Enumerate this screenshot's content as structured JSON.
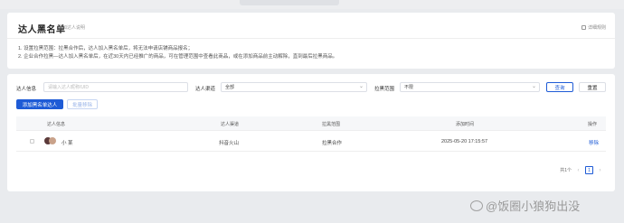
{
  "header": {
    "title": "达人黑名单",
    "subtitle": "添加达人说明",
    "help_label": "详细规则"
  },
  "description": [
    "1. 设置拉黑范围：拉黑合作后，达人加入黑名单后，将无法申请店铺商品报名；",
    "2. 企业合作拉黑—达人加入黑名单后，在近30天内已经推广的商品，可在管理范围中查看此商品，或在添加商品前主动解除，直到最后拉黑商品。"
  ],
  "filters": {
    "influencer_label": "达人信息",
    "influencer_placeholder": "请输入达人昵称/UID",
    "channel_label": "达人渠道",
    "channel_value": "全部",
    "scope_label": "拉黑范围",
    "scope_value": "不限",
    "query_button": "查询",
    "reset_button": "重置"
  },
  "actions": {
    "add_button": "添加黑名单达人",
    "batch_button": "批量移除"
  },
  "table": {
    "columns": [
      "达人信息",
      "达人渠道",
      "拉黑范围",
      "添加时间",
      "操作"
    ],
    "rows": [
      {
        "name": "小 某",
        "channel": "抖音火山",
        "scope": "拉黑合作",
        "added_time": "2025-05-20 17:15:57",
        "action": "移除"
      }
    ]
  },
  "pagination": {
    "total": "共1个",
    "prev": "‹",
    "current": "1",
    "next": "›"
  },
  "watermark": "@饭圈小狼狗出没"
}
